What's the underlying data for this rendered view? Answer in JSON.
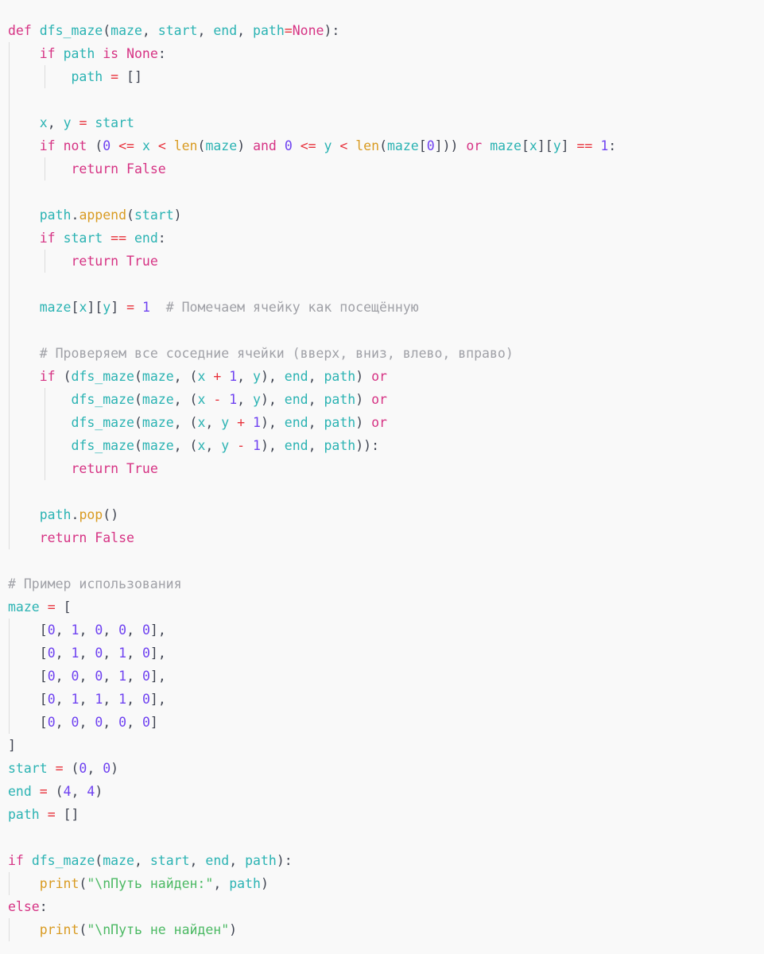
{
  "editor": {
    "language": "python",
    "background_color": "#f9f9f9",
    "indent_guide_color": "#dcdcdc",
    "palette": {
      "keyword": "#d63384",
      "constant": "#d63384",
      "name": "#2bb3b3",
      "builtin": "#d99b22",
      "number": "#6f42f1",
      "operator": "#e8323c",
      "string": "#4bb963",
      "comment": "#a0a1a7",
      "punctuation": "#3f4451"
    }
  },
  "code": {
    "lines": [
      {
        "n": 1,
        "indent": 0,
        "text": "def dfs_maze(maze, start, end, path=None):"
      },
      {
        "n": 2,
        "indent": 1,
        "text": "    if path is None:"
      },
      {
        "n": 3,
        "indent": 2,
        "text": "        path = []"
      },
      {
        "n": 4,
        "indent": 1,
        "text": ""
      },
      {
        "n": 5,
        "indent": 1,
        "text": "    x, y = start"
      },
      {
        "n": 6,
        "indent": 1,
        "text": "    if not (0 <= x < len(maze) and 0 <= y < len(maze[0])) or maze[x][y] == 1:"
      },
      {
        "n": 7,
        "indent": 2,
        "text": "        return False"
      },
      {
        "n": 8,
        "indent": 1,
        "text": ""
      },
      {
        "n": 9,
        "indent": 1,
        "text": "    path.append(start)"
      },
      {
        "n": 10,
        "indent": 1,
        "text": "    if start == end:"
      },
      {
        "n": 11,
        "indent": 2,
        "text": "        return True"
      },
      {
        "n": 12,
        "indent": 1,
        "text": ""
      },
      {
        "n": 13,
        "indent": 1,
        "text": "    maze[x][y] = 1  # Помечаем ячейку как посещённую"
      },
      {
        "n": 14,
        "indent": 1,
        "text": ""
      },
      {
        "n": 15,
        "indent": 1,
        "text": "    # Проверяем все соседние ячейки (вверх, вниз, влево, вправо)"
      },
      {
        "n": 16,
        "indent": 1,
        "text": "    if (dfs_maze(maze, (x + 1, y), end, path) or"
      },
      {
        "n": 17,
        "indent": 2,
        "text": "        dfs_maze(maze, (x - 1, y), end, path) or"
      },
      {
        "n": 18,
        "indent": 2,
        "text": "        dfs_maze(maze, (x, y + 1), end, path) or"
      },
      {
        "n": 19,
        "indent": 2,
        "text": "        dfs_maze(maze, (x, y - 1), end, path)):"
      },
      {
        "n": 20,
        "indent": 2,
        "text": "        return True"
      },
      {
        "n": 21,
        "indent": 1,
        "text": ""
      },
      {
        "n": 22,
        "indent": 1,
        "text": "    path.pop()"
      },
      {
        "n": 23,
        "indent": 1,
        "text": "    return False"
      },
      {
        "n": 24,
        "indent": 0,
        "text": ""
      },
      {
        "n": 25,
        "indent": 0,
        "text": "# Пример использования"
      },
      {
        "n": 26,
        "indent": 0,
        "text": "maze = ["
      },
      {
        "n": 27,
        "indent": 1,
        "text": "    [0, 1, 0, 0, 0],"
      },
      {
        "n": 28,
        "indent": 1,
        "text": "    [0, 1, 0, 1, 0],"
      },
      {
        "n": 29,
        "indent": 1,
        "text": "    [0, 0, 0, 1, 0],"
      },
      {
        "n": 30,
        "indent": 1,
        "text": "    [0, 1, 1, 1, 0],"
      },
      {
        "n": 31,
        "indent": 1,
        "text": "    [0, 0, 0, 0, 0]"
      },
      {
        "n": 32,
        "indent": 0,
        "text": "]"
      },
      {
        "n": 33,
        "indent": 0,
        "text": "start = (0, 0)"
      },
      {
        "n": 34,
        "indent": 0,
        "text": "end = (4, 4)"
      },
      {
        "n": 35,
        "indent": 0,
        "text": "path = []"
      },
      {
        "n": 36,
        "indent": 0,
        "text": ""
      },
      {
        "n": 37,
        "indent": 0,
        "text": "if dfs_maze(maze, start, end, path):"
      },
      {
        "n": 38,
        "indent": 1,
        "text": "    print(\"\\nПуть найден:\", path)"
      },
      {
        "n": 39,
        "indent": 0,
        "text": "else:"
      },
      {
        "n": 40,
        "indent": 1,
        "text": "    print(\"\\nПуть не найден\")"
      }
    ],
    "comments": [
      "# Помечаем ячейку как посещённую",
      "# Проверяем все соседние ячейки (вверх, вниз, влево, вправо)",
      "# Пример использования"
    ],
    "strings": [
      "\"\\nПуть найден:\"",
      "\"\\nПуть не найден\""
    ],
    "function_name": "dfs_maze",
    "maze_matrix": [
      [
        0,
        1,
        0,
        0,
        0
      ],
      [
        0,
        1,
        0,
        1,
        0
      ],
      [
        0,
        0,
        0,
        1,
        0
      ],
      [
        0,
        1,
        1,
        1,
        0
      ],
      [
        0,
        0,
        0,
        0,
        0
      ]
    ],
    "start_tuple": "(0, 0)",
    "end_tuple": "(4, 4)"
  }
}
